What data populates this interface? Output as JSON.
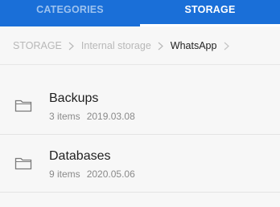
{
  "tabs": [
    {
      "label": "CATEGORIES",
      "active": false
    },
    {
      "label": "STORAGE",
      "active": true
    }
  ],
  "breadcrumb": {
    "items": [
      "STORAGE",
      "Internal storage",
      "WhatsApp"
    ],
    "separator_icon": "chevron-right-icon"
  },
  "folders": [
    {
      "name": "Backups",
      "count": "3 items",
      "date": "2019.03.08",
      "icon": "folder-icon"
    },
    {
      "name": "Databases",
      "count": "9 items",
      "date": "2020.05.06",
      "icon": "folder-icon"
    }
  ],
  "colors": {
    "accent": "#1a6fd8",
    "background": "#f7f7f7",
    "text_primary": "#1f1f1f",
    "text_secondary": "#8a8a8a",
    "crumb_inactive": "#b8b8b8"
  }
}
